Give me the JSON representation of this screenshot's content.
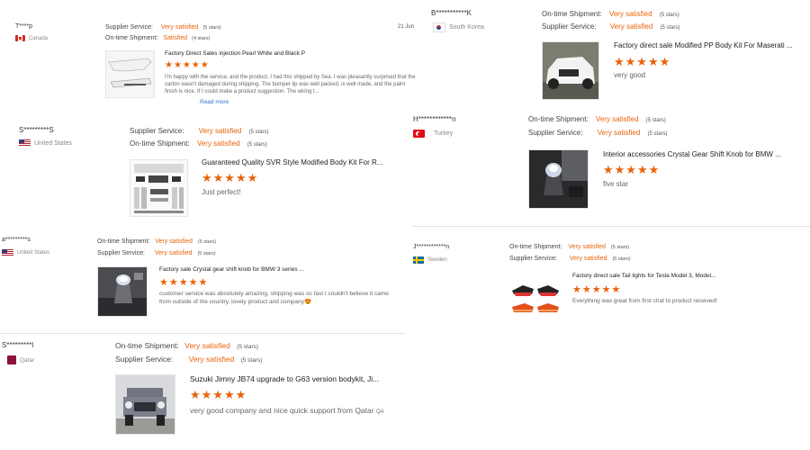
{
  "reviews": [
    {
      "user": "T****p",
      "country": "Canada",
      "row1": {
        "label": "Supplier Service:",
        "value": "Very satisfied",
        "stars": "(5 stars)"
      },
      "row2": {
        "label": "On-time Shipment:",
        "value": "Satisfied",
        "stars": "(4 stars)"
      },
      "date": "21 Jun",
      "product": "Factory Direct Sales injection Pearl White and Black P",
      "rating": "★★★★★",
      "text": "I'm happy with the service, and the product. I had this shipped by Sea. I was pleasantly surprised that the carton wasn't damaged during shipping. The bumper lip was well packed, is well made, and the paint finish is nice. If I could make a product suggestion. The wiring t...",
      "read_more": "Read more",
      "thumb": "white-bumper-lip"
    },
    {
      "user": "S*********S",
      "country": "United States",
      "row1": {
        "label": "Supplier Service:",
        "value": "Very satisfied",
        "stars": "(5 stars)"
      },
      "row2": {
        "label": "On-time Shipment:",
        "value": "Very satisfied",
        "stars": "(5 stars)"
      },
      "product": "Guaranteed Quality SVR Style Modified Body Kit For R...",
      "rating": "★★★★★",
      "text": "Just perfect!",
      "thumb": "body-kit-parts"
    },
    {
      "user": "a*********s",
      "country": "United States",
      "row1": {
        "label": "On-time Shipment:",
        "value": "Very satisfied",
        "stars": "(5 stars)"
      },
      "row2": {
        "label": "Supplier Service:",
        "value": "Very satisfied",
        "stars": "(5 stars)"
      },
      "product": "Factory sale Crystal gear shift knob for BMW 3 series ...",
      "rating": "★★★★★",
      "text": "customer service was absolutely amazing. shipping was so fast I couldn't believe it came from outside of the country. lovely product and company😍",
      "thumb": "gear-shift-knob"
    },
    {
      "user": "S*********l",
      "country": "Qatar",
      "row1": {
        "label": "On-time Shipment:",
        "value": "Very satisfied",
        "stars": "(5 stars)"
      },
      "row2": {
        "label": "Supplier Service:",
        "value": "Very satisfied",
        "stars": "(5 stars)"
      },
      "product": "Suzuki Jimny JB74 upgrade to G63 version bodykit, Ji...",
      "rating": "★★★★★",
      "text": "very good company and nice quick support from Qatar",
      "text_suffix": "QA",
      "thumb": "jimny-g63"
    },
    {
      "user": "B***********K",
      "country": "South Korea",
      "row1": {
        "label": "On-time Shipment:",
        "value": "Very satisfied",
        "stars": "(5 stars)"
      },
      "row2": {
        "label": "Supplier Service:",
        "value": "Very satisfied",
        "stars": "(5 stars)"
      },
      "product": "Factory direct sale Modified PP Body Kit For Maserati ...",
      "rating": "★★★★★",
      "text": "very good",
      "thumb": "white-maserati"
    },
    {
      "user": "H************n",
      "country": "Turkey",
      "row1": {
        "label": "On-time Shipment:",
        "value": "Very satisfied",
        "stars": "(5 stars)"
      },
      "row2": {
        "label": "Supplier Service:",
        "value": "Very satisfied",
        "stars": "(5 stars)"
      },
      "product": "Interior accessories Crystal Gear Shift Knob for BMW ...",
      "rating": "★★★★★",
      "text": "five star",
      "thumb": "crystal-knob"
    },
    {
      "user": "J************n",
      "country": "Sweden",
      "row1": {
        "label": "On-time Shipment:",
        "value": "Very satisfied",
        "stars": "(5 stars)"
      },
      "row2": {
        "label": "Supplier Service:",
        "value": "Very satisfied",
        "stars": "(5 stars)"
      },
      "product": "Factory direct sale Tail lights for Tesla Model 3, Model...",
      "rating": "★★★★★",
      "text": "Everything was great from first chat to product received!",
      "thumb": "tail-lights"
    }
  ],
  "colors": {
    "accent": "#e8630a",
    "link": "#2b73d3",
    "divider": "#e2e2e2"
  }
}
